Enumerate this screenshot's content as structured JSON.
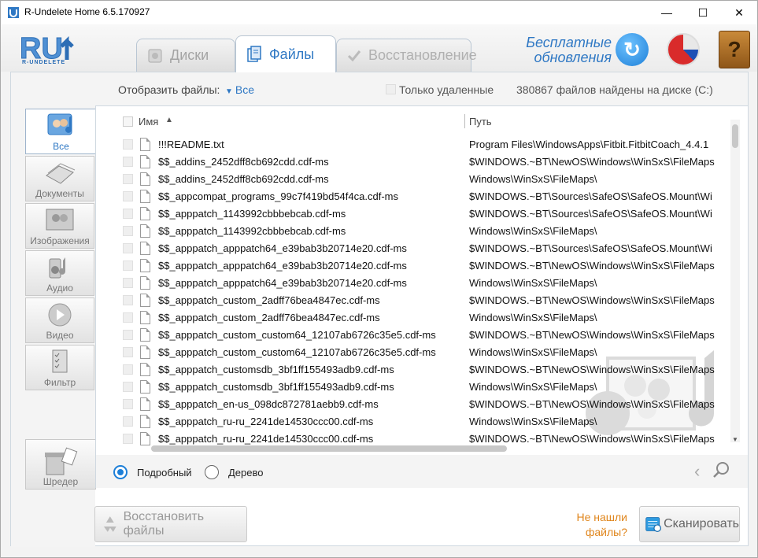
{
  "window": {
    "title": "R-Undelete Home 6.5.170927",
    "minimize": "—",
    "maximize": "☐",
    "close": "✕"
  },
  "header": {
    "logo_text": "R-UNDELETE",
    "tabs": [
      {
        "label": "Диски",
        "icon": "disk-icon",
        "state": "disabled"
      },
      {
        "label": "Файлы",
        "icon": "files-icon",
        "state": "active"
      },
      {
        "label": "Восстановление",
        "icon": "checkmark-icon",
        "state": "disabled"
      }
    ],
    "free_updates_line1": "Бесплатные",
    "free_updates_line2": "обновления",
    "update_icon": "refresh-icon",
    "language_icon": "language-flag-icon",
    "help_icon": "help-book-icon",
    "help_glyph": "?"
  },
  "filter": {
    "show_label": "Отобразить файлы:",
    "show_value": "Все",
    "only_deleted_label": "Только удаленные",
    "files_found": "380867 файлов найдены на диске (C:)"
  },
  "categories": [
    {
      "label": "Все",
      "icon": "all-files-icon",
      "active": true
    },
    {
      "label": "Документы",
      "icon": "documents-icon",
      "active": false
    },
    {
      "label": "Изображения",
      "icon": "images-icon",
      "active": false
    },
    {
      "label": "Аудио",
      "icon": "audio-icon",
      "active": false
    },
    {
      "label": "Видео",
      "icon": "video-icon",
      "active": false
    },
    {
      "label": "Фильтр",
      "icon": "filter-icon",
      "active": false
    }
  ],
  "shredder": {
    "label": "Шредер",
    "icon": "shredder-icon"
  },
  "table": {
    "col_name": "Имя",
    "col_path": "Путь",
    "sort_indicator": "▲",
    "rows": [
      {
        "name": "!!!README.txt",
        "path": "Program Files\\WindowsApps\\Fitbit.FitbitCoach_4.4.1"
      },
      {
        "name": "$$_addins_2452dff8cb692cdd.cdf-ms",
        "path": "$WINDOWS.~BT\\NewOS\\Windows\\WinSxS\\FileMaps"
      },
      {
        "name": "$$_addins_2452dff8cb692cdd.cdf-ms",
        "path": "Windows\\WinSxS\\FileMaps\\"
      },
      {
        "name": "$$_appcompat_programs_99c7f419bd54f4ca.cdf-ms",
        "path": "$WINDOWS.~BT\\Sources\\SafeOS\\SafeOS.Mount\\Wi"
      },
      {
        "name": "$$_apppatch_1143992cbbbebcab.cdf-ms",
        "path": "$WINDOWS.~BT\\Sources\\SafeOS\\SafeOS.Mount\\Wi"
      },
      {
        "name": "$$_apppatch_1143992cbbbebcab.cdf-ms",
        "path": "Windows\\WinSxS\\FileMaps\\"
      },
      {
        "name": "$$_apppatch_apppatch64_e39bab3b20714e20.cdf-ms",
        "path": "$WINDOWS.~BT\\Sources\\SafeOS\\SafeOS.Mount\\Wi"
      },
      {
        "name": "$$_apppatch_apppatch64_e39bab3b20714e20.cdf-ms",
        "path": "$WINDOWS.~BT\\NewOS\\Windows\\WinSxS\\FileMaps"
      },
      {
        "name": "$$_apppatch_apppatch64_e39bab3b20714e20.cdf-ms",
        "path": "Windows\\WinSxS\\FileMaps\\"
      },
      {
        "name": "$$_apppatch_custom_2adff76bea4847ec.cdf-ms",
        "path": "$WINDOWS.~BT\\NewOS\\Windows\\WinSxS\\FileMaps"
      },
      {
        "name": "$$_apppatch_custom_2adff76bea4847ec.cdf-ms",
        "path": "Windows\\WinSxS\\FileMaps\\"
      },
      {
        "name": "$$_apppatch_custom_custom64_12107ab6726c35e5.cdf-ms",
        "path": "$WINDOWS.~BT\\NewOS\\Windows\\WinSxS\\FileMaps"
      },
      {
        "name": "$$_apppatch_custom_custom64_12107ab6726c35e5.cdf-ms",
        "path": "Windows\\WinSxS\\FileMaps\\"
      },
      {
        "name": "$$_apppatch_customsdb_3bf1ff155493adb9.cdf-ms",
        "path": "$WINDOWS.~BT\\NewOS\\Windows\\WinSxS\\FileMaps"
      },
      {
        "name": "$$_apppatch_customsdb_3bf1ff155493adb9.cdf-ms",
        "path": "Windows\\WinSxS\\FileMaps\\"
      },
      {
        "name": "$$_apppatch_en-us_098dc872781aebb9.cdf-ms",
        "path": "$WINDOWS.~BT\\NewOS\\Windows\\WinSxS\\FileMaps"
      },
      {
        "name": "$$_apppatch_ru-ru_2241de14530ccc00.cdf-ms",
        "path": "Windows\\WinSxS\\FileMaps\\"
      },
      {
        "name": "$$_apppatch_ru-ru_2241de14530ccc00.cdf-ms",
        "path": "$WINDOWS.~BT\\NewOS\\Windows\\WinSxS\\FileMaps"
      }
    ]
  },
  "view_mode": {
    "detailed": "Подробный",
    "tree": "Дерево",
    "selected": "detailed",
    "nav_glyph": "‹"
  },
  "actions": {
    "restore_label": "Восстановить файлы",
    "not_found_line1": "Не нашли",
    "not_found_line2": "файлы?",
    "scan_label": "Сканировать"
  },
  "colors": {
    "accent": "#2f78c4",
    "link_orange": "#e0861d"
  }
}
